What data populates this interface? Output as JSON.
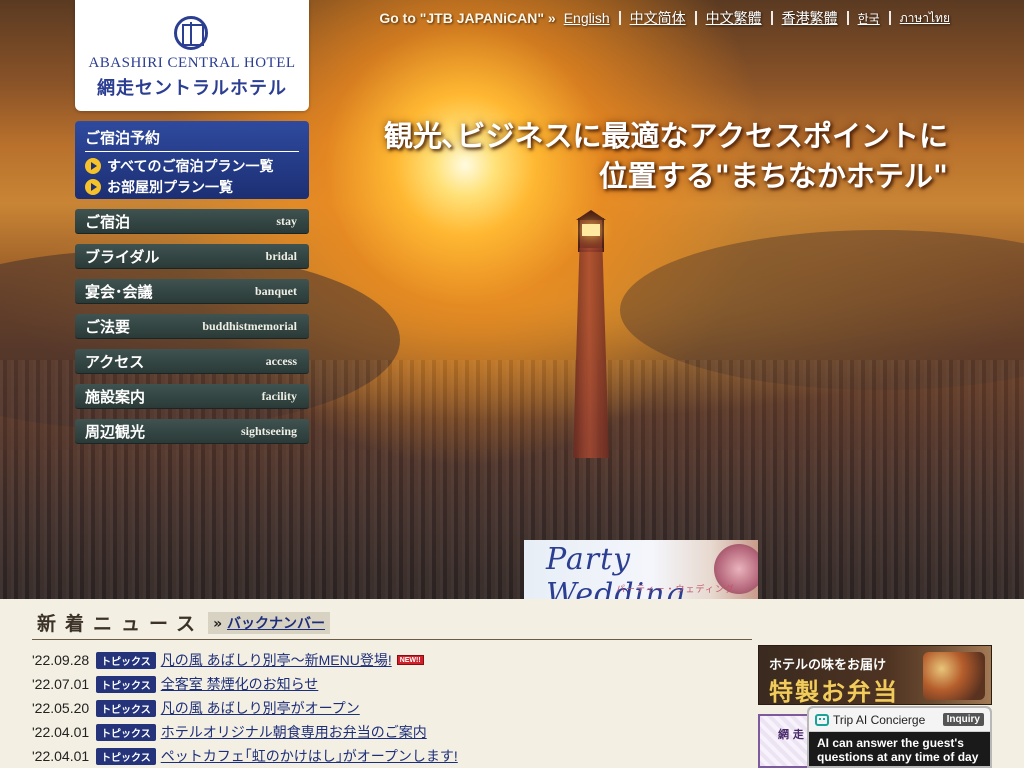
{
  "topnav": {
    "jtb_label": "Go to \"JTB JAPANiCAN\" »",
    "links": [
      "English",
      "中文简体",
      "中文繁體",
      "香港繁體",
      "한국",
      "ภาษาไทย"
    ]
  },
  "logo": {
    "en": "ABASHIRI CENTRAL HOTEL",
    "ja": "網走セントラルホテル"
  },
  "hero": {
    "line1": "観光､ビジネスに最適なアクセスポイントに",
    "line2": "位置する\"まちなかホテル\""
  },
  "reserve": {
    "title": "ご宿泊予約",
    "links": [
      "すべてのご宿泊プラン一覧",
      "お部屋別プラン一覧"
    ]
  },
  "menu": [
    {
      "ja": "ご宿泊",
      "en": "stay"
    },
    {
      "ja": "ブライダル",
      "en": "bridal"
    },
    {
      "ja": "宴会･会議",
      "en": "banquet"
    },
    {
      "ja": "ご法要",
      "en": "buddhistmemorial"
    },
    {
      "ja": "アクセス",
      "en": "access"
    },
    {
      "ja": "施設案内",
      "en": "facility"
    },
    {
      "ja": "周辺観光",
      "en": "sightseeing"
    }
  ],
  "party_banner": {
    "title": "Party Wedding",
    "subtitle": "パーティー・ウェディング"
  },
  "news": {
    "title": "新着ニュース",
    "back_prefix": "»",
    "back_label": "バックナンバー",
    "items": [
      {
        "date": "'22.09.28",
        "tag": "トピックス",
        "title": "凡の風 あばしり別亭〜新MENU登場!",
        "badge": "NEW!!"
      },
      {
        "date": "'22.07.01",
        "tag": "トピックス",
        "title": "全客室 禁煙化のお知らせ"
      },
      {
        "date": "'22.05.20",
        "tag": "トピックス",
        "title": "凡の風 あばしり別亭がオープン"
      },
      {
        "date": "'22.04.01",
        "tag": "トピックス",
        "title": "ホテルオリジナル朝食専用お弁当のご案内"
      },
      {
        "date": "'22.04.01",
        "tag": "トピックス",
        "title": "ペットカフェ｢虹のかけはし｣がオープンします!"
      }
    ]
  },
  "bento_banner": {
    "line1": "ホテルの味をお届け",
    "line2": "特製お弁当"
  },
  "purple_banner": {
    "text": "網 走"
  },
  "trip_ai": {
    "name": "Trip AI Concierge",
    "button": "Inquiry",
    "message_line1": "AI can answer the guest's",
    "message_line2": "questions at any time of day"
  },
  "colors": {
    "brand_navy": "#2b3e91",
    "menu_bg": "#2f403e",
    "news_tag": "#24337a",
    "accent_gold": "#f5c22b"
  }
}
